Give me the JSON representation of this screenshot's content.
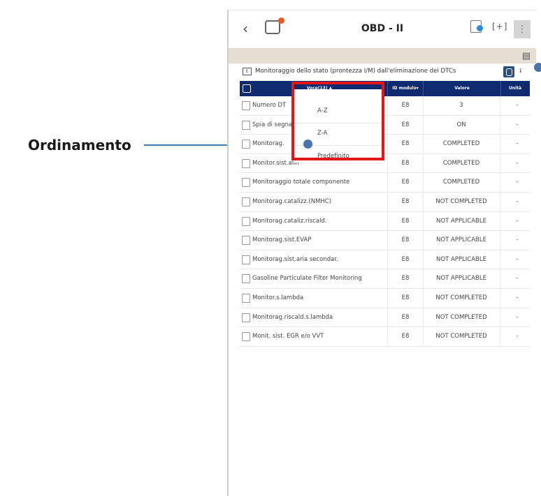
{
  "callout": {
    "label": "Ordinamento"
  },
  "app": {
    "title": "OBD - II"
  },
  "section": {
    "text": "Monitoraggio dello stato (prontezza I/M) dall'eliminazione dei DTCs"
  },
  "table": {
    "headers": {
      "name": "Voce(13)",
      "id": "ID modulo",
      "value": "Valore",
      "unit": "Unità"
    },
    "rows": [
      {
        "name": "Numero DT",
        "id": "E8",
        "value": "3",
        "unit": "-"
      },
      {
        "name": "Spia di segnalaz",
        "id": "E8",
        "value": "ON",
        "unit": "-"
      },
      {
        "name": "Monitorag.",
        "id": "E8",
        "value": "COMPLETED",
        "unit": "-"
      },
      {
        "name": "Monitor.sist.alin",
        "id": "E8",
        "value": "COMPLETED",
        "unit": "-"
      },
      {
        "name": "Monitoraggio totale componente",
        "id": "E8",
        "value": "COMPLETED",
        "unit": "-"
      },
      {
        "name": "Monitorag.catalizz.(NMHC)",
        "id": "E8",
        "value": "NOT COMPLETED",
        "unit": "-"
      },
      {
        "name": "Monitorag.cataliz.riscald.",
        "id": "E8",
        "value": "NOT APPLICABLE",
        "unit": "-"
      },
      {
        "name": "Monitorag.sist.EVAP",
        "id": "E8",
        "value": "NOT APPLICABLE",
        "unit": "-"
      },
      {
        "name": "Monitorag.sist.aria secondar.",
        "id": "E8",
        "value": "NOT APPLICABLE",
        "unit": "-"
      },
      {
        "name": "Gasoline Particulate Filter Monitoring",
        "id": "E8",
        "value": "NOT APPLICABLE",
        "unit": "-"
      },
      {
        "name": "Monitor.s.lambda",
        "id": "E8",
        "value": "NOT COMPLETED",
        "unit": "-"
      },
      {
        "name": "Monitorag.riscald.s.lambda",
        "id": "E8",
        "value": "NOT COMPLETED",
        "unit": "-"
      },
      {
        "name": "Monit. sist. EGR e/o VVT",
        "id": "E8",
        "value": "NOT COMPLETED",
        "unit": "-"
      }
    ]
  },
  "sort_menu": {
    "items": [
      "A-Z",
      "Z-A",
      "Predefinito"
    ]
  },
  "colors": {
    "header_bg": "#0f2a6e",
    "highlight": "#e11717",
    "callout": "#4a74ad",
    "beige_bar": "#e6ded3"
  },
  "icons": [
    "back-icon",
    "app-icon",
    "battery-icon",
    "capture-icon",
    "menu-icon",
    "car-icon",
    "filter-icon"
  ]
}
